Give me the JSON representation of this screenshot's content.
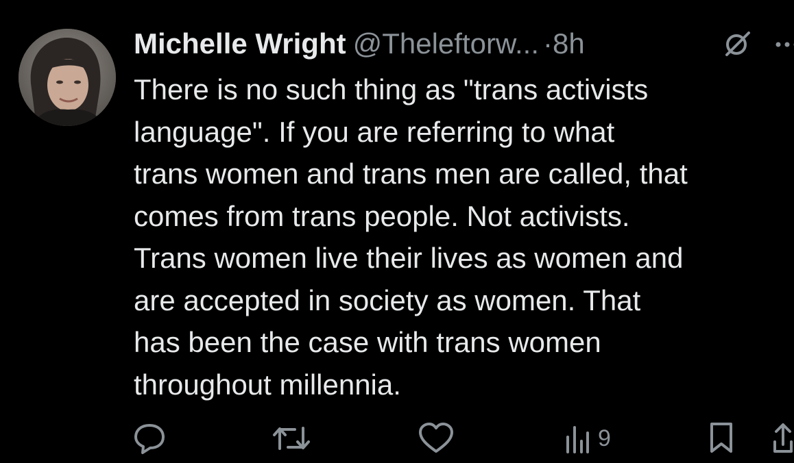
{
  "tweet": {
    "author_name": "Michelle Wright",
    "author_handle": "@Theleftorw...",
    "separator": "·",
    "timestamp": "8h",
    "text_lines": [
      "There is no such thing as \"trans activists",
      "language\". If you are referring to what",
      "trans women and trans men are called, that",
      "comes from trans people. Not activists.",
      "Trans women live their lives as women and",
      "are accepted in society as women. That",
      "has been the case with trans women",
      "throughout millennia."
    ],
    "views_count": "9"
  },
  "icons": {
    "avatar": "profile-photo",
    "grok": "grok-icon",
    "more": "more-icon",
    "reply": "reply-icon",
    "retweet": "retweet-icon",
    "like": "like-icon",
    "views": "views-icon",
    "bookmark": "bookmark-icon",
    "share": "share-icon"
  },
  "colors": {
    "background": "#000000",
    "primary_text": "#e7e9ea",
    "secondary_text": "#8b9298"
  }
}
